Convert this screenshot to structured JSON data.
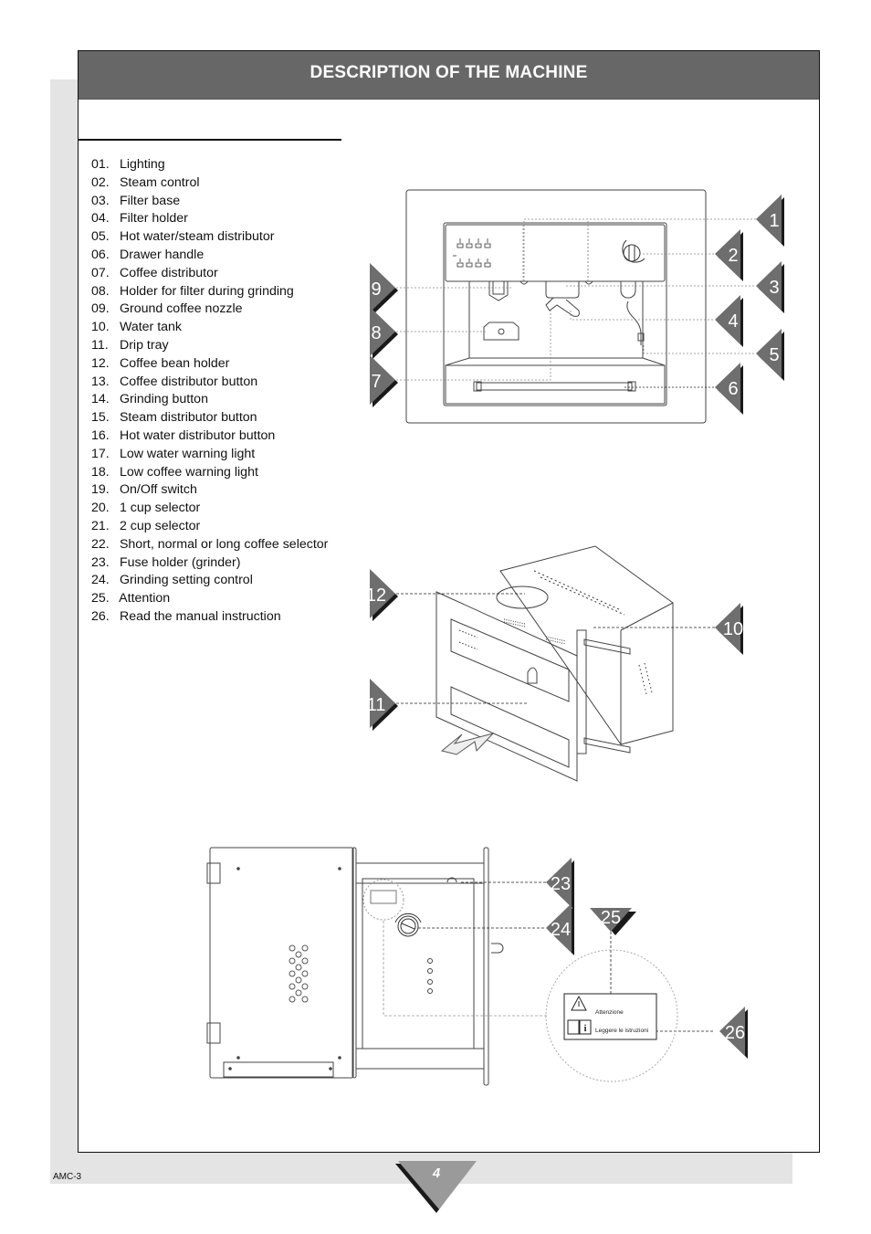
{
  "page": {
    "title": "DESCRIPTION OF THE MACHINE",
    "page_number": "4",
    "doc_code": "AMC-3"
  },
  "legend": [
    {
      "num": "01.",
      "label": "Lighting"
    },
    {
      "num": "02.",
      "label": "Steam control"
    },
    {
      "num": "03.",
      "label": "Filter base"
    },
    {
      "num": "04.",
      "label": "Filter holder"
    },
    {
      "num": "05.",
      "label": "Hot water/steam distributor"
    },
    {
      "num": "06.",
      "label": "Drawer handle"
    },
    {
      "num": "07.",
      "label": "Coffee distributor"
    },
    {
      "num": "08.",
      "label": "Holder for filter during grinding"
    },
    {
      "num": "09.",
      "label": "Ground coffee nozzle"
    },
    {
      "num": "10.",
      "label": "Water tank"
    },
    {
      "num": "11.",
      "label": "Drip tray"
    },
    {
      "num": "12.",
      "label": "Coffee bean holder"
    },
    {
      "num": "13.",
      "label": "Coffee distributor button"
    },
    {
      "num": "14.",
      "label": "Grinding button"
    },
    {
      "num": "15.",
      "label": "Steam distributor button"
    },
    {
      "num": "16.",
      "label": "Hot water distributor button"
    },
    {
      "num": "17.",
      "label": "Low water warning light"
    },
    {
      "num": "18.",
      "label": "Low coffee warning light"
    },
    {
      "num": "19.",
      "label": "On/Off switch"
    },
    {
      "num": "20.",
      "label": "1 cup selector"
    },
    {
      "num": "21.",
      "label": "2 cup selector"
    },
    {
      "num": "22.",
      "label": "Short, normal or long coffee selector"
    },
    {
      "num": "23.",
      "label": "Fuse holder (grinder)"
    },
    {
      "num": "24.",
      "label": "Grinding setting control"
    },
    {
      "num": "25.",
      "label": "Attention"
    },
    {
      "num": "26.",
      "label": "Read the manual instruction"
    }
  ],
  "callouts": {
    "c1": "1",
    "c2": "2",
    "c3": "3",
    "c4": "4",
    "c5": "5",
    "c6": "6",
    "c7": "7",
    "c8": "8",
    "c9": "9",
    "c10": "10",
    "c11": "11",
    "c12": "12",
    "c23": "23",
    "c24": "24",
    "c25": "25",
    "c26": "26"
  },
  "warning_label": {
    "attention": "Attenzione",
    "read_instructions": "Leggere le istruzioni"
  },
  "colors": {
    "header_bg": "#676767",
    "callout_fill": "#6e6e6e",
    "callout_shadow": "#1a1a1a",
    "page_strip": "#e4e4e4"
  }
}
